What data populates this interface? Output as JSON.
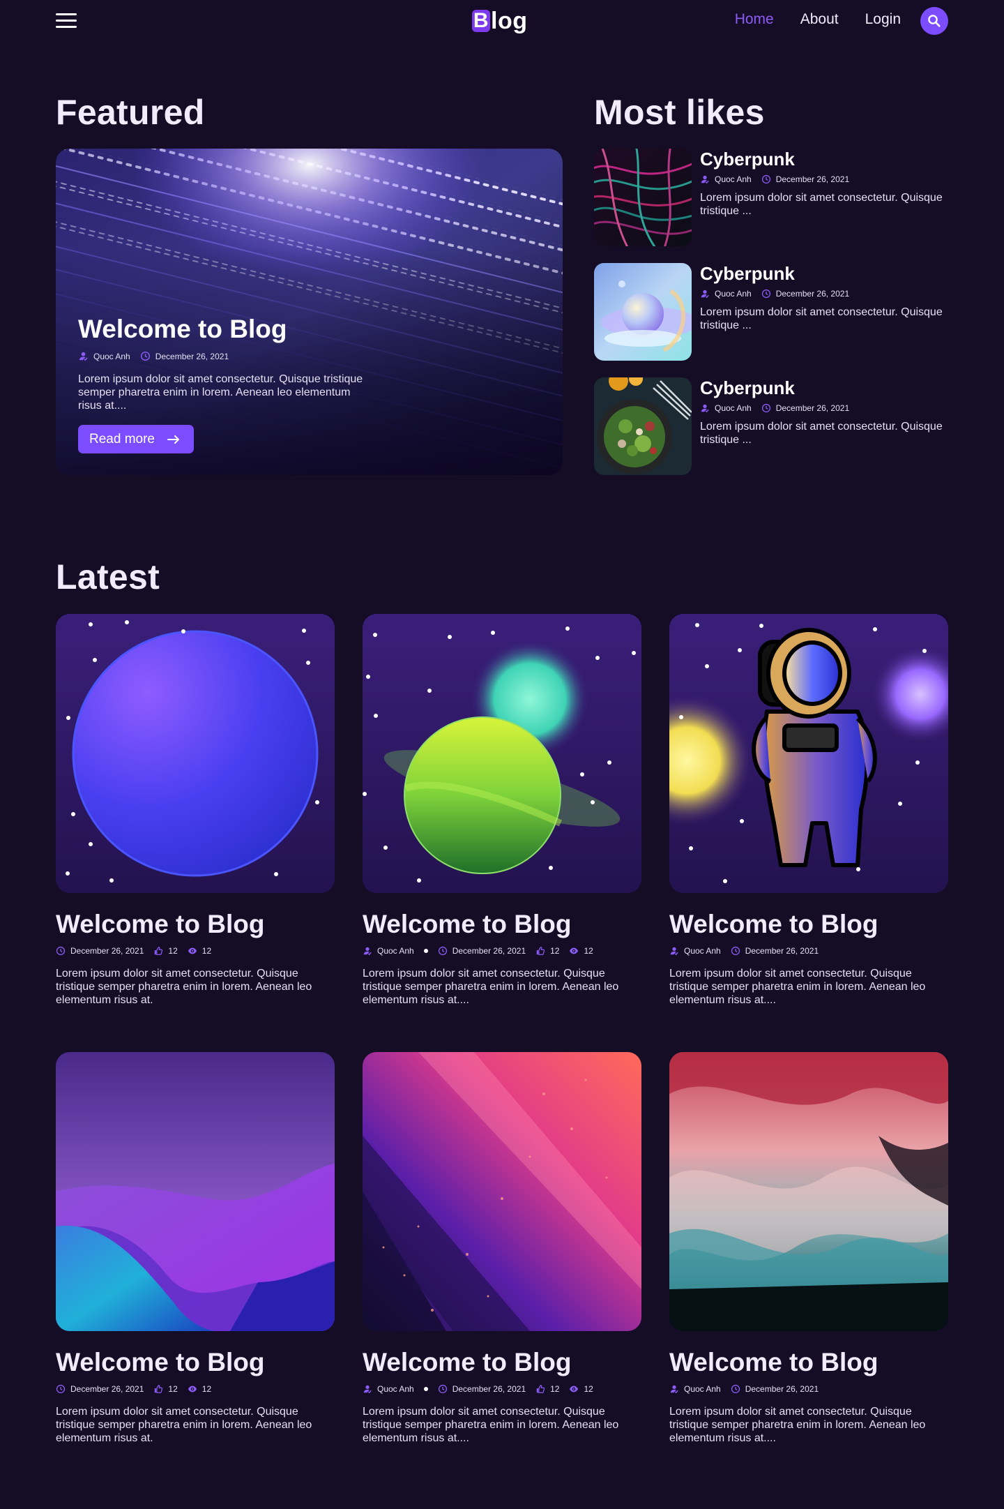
{
  "header": {
    "logo_initial": "B",
    "logo_rest": "log",
    "nav": [
      "Home",
      "About",
      "Login"
    ]
  },
  "sections": {
    "featured": "Featured",
    "most_likes": "Most likes",
    "latest": "Latest"
  },
  "featured": {
    "title": "Welcome to Blog",
    "author": "Quoc Anh",
    "date": "December 26, 2021",
    "excerpt": "Lorem ipsum dolor sit amet consectetur. Quisque tristique semper pharetra enim in lorem. Aenean leo elementum risus at....",
    "button": "Read more"
  },
  "most_likes": [
    {
      "title": "Cyberpunk",
      "author": "Quoc Anh",
      "date": "December 26, 2021",
      "excerpt": "Lorem ipsum dolor sit amet consectetur. Quisque tristique ..."
    },
    {
      "title": "Cyberpunk",
      "author": "Quoc Anh",
      "date": "December 26, 2021",
      "excerpt": "Lorem ipsum dolor sit amet consectetur. Quisque tristique ..."
    },
    {
      "title": "Cyberpunk",
      "author": "Quoc Anh",
      "date": "December 26, 2021",
      "excerpt": "Lorem ipsum dolor sit amet consectetur. Quisque tristique ..."
    }
  ],
  "latest": [
    {
      "title": "Welcome to Blog",
      "date": "December 26, 2021",
      "likes": "12",
      "views": "12",
      "excerpt": "Lorem ipsum dolor sit amet consectetur. Quisque tristique semper pharetra enim in lorem. Aenean leo elementum risus at."
    },
    {
      "title": "Welcome to Blog",
      "author": "Quoc Anh",
      "date": "December 26, 2021",
      "likes": "12",
      "views": "12",
      "excerpt": "Lorem ipsum dolor sit amet consectetur. Quisque tristique semper pharetra enim in lorem. Aenean leo elementum risus at...."
    },
    {
      "title": "Welcome to Blog",
      "author": "Quoc Anh",
      "date": "December 26, 2021",
      "excerpt": "Lorem ipsum dolor sit amet consectetur. Quisque tristique semper pharetra enim in lorem. Aenean leo elementum risus at...."
    },
    {
      "title": "Welcome to Blog",
      "date": "December 26, 2021",
      "likes": "12",
      "views": "12",
      "excerpt": "Lorem ipsum dolor sit amet consectetur. Quisque tristique semper pharetra enim in lorem. Aenean leo elementum risus at."
    },
    {
      "title": "Welcome to Blog",
      "author": "Quoc Anh",
      "date": "December 26, 2021",
      "likes": "12",
      "views": "12",
      "excerpt": "Lorem ipsum dolor sit amet consectetur. Quisque tristique semper pharetra enim in lorem. Aenean leo elementum risus at...."
    },
    {
      "title": "Welcome to Blog",
      "author": "Quoc Anh",
      "date": "December 26, 2021",
      "excerpt": "Lorem ipsum dolor sit amet consectetur. Quisque tristique semper pharetra enim in lorem. Aenean leo elementum risus at...."
    }
  ],
  "colors": {
    "background": "#150c26",
    "accent": "#7c4dff",
    "active_nav": "#8b5cf6"
  },
  "icons": [
    "menu-icon",
    "search-icon",
    "user-icon",
    "clock-icon",
    "thumb-up-icon",
    "eye-icon",
    "arrow-right-icon"
  ]
}
